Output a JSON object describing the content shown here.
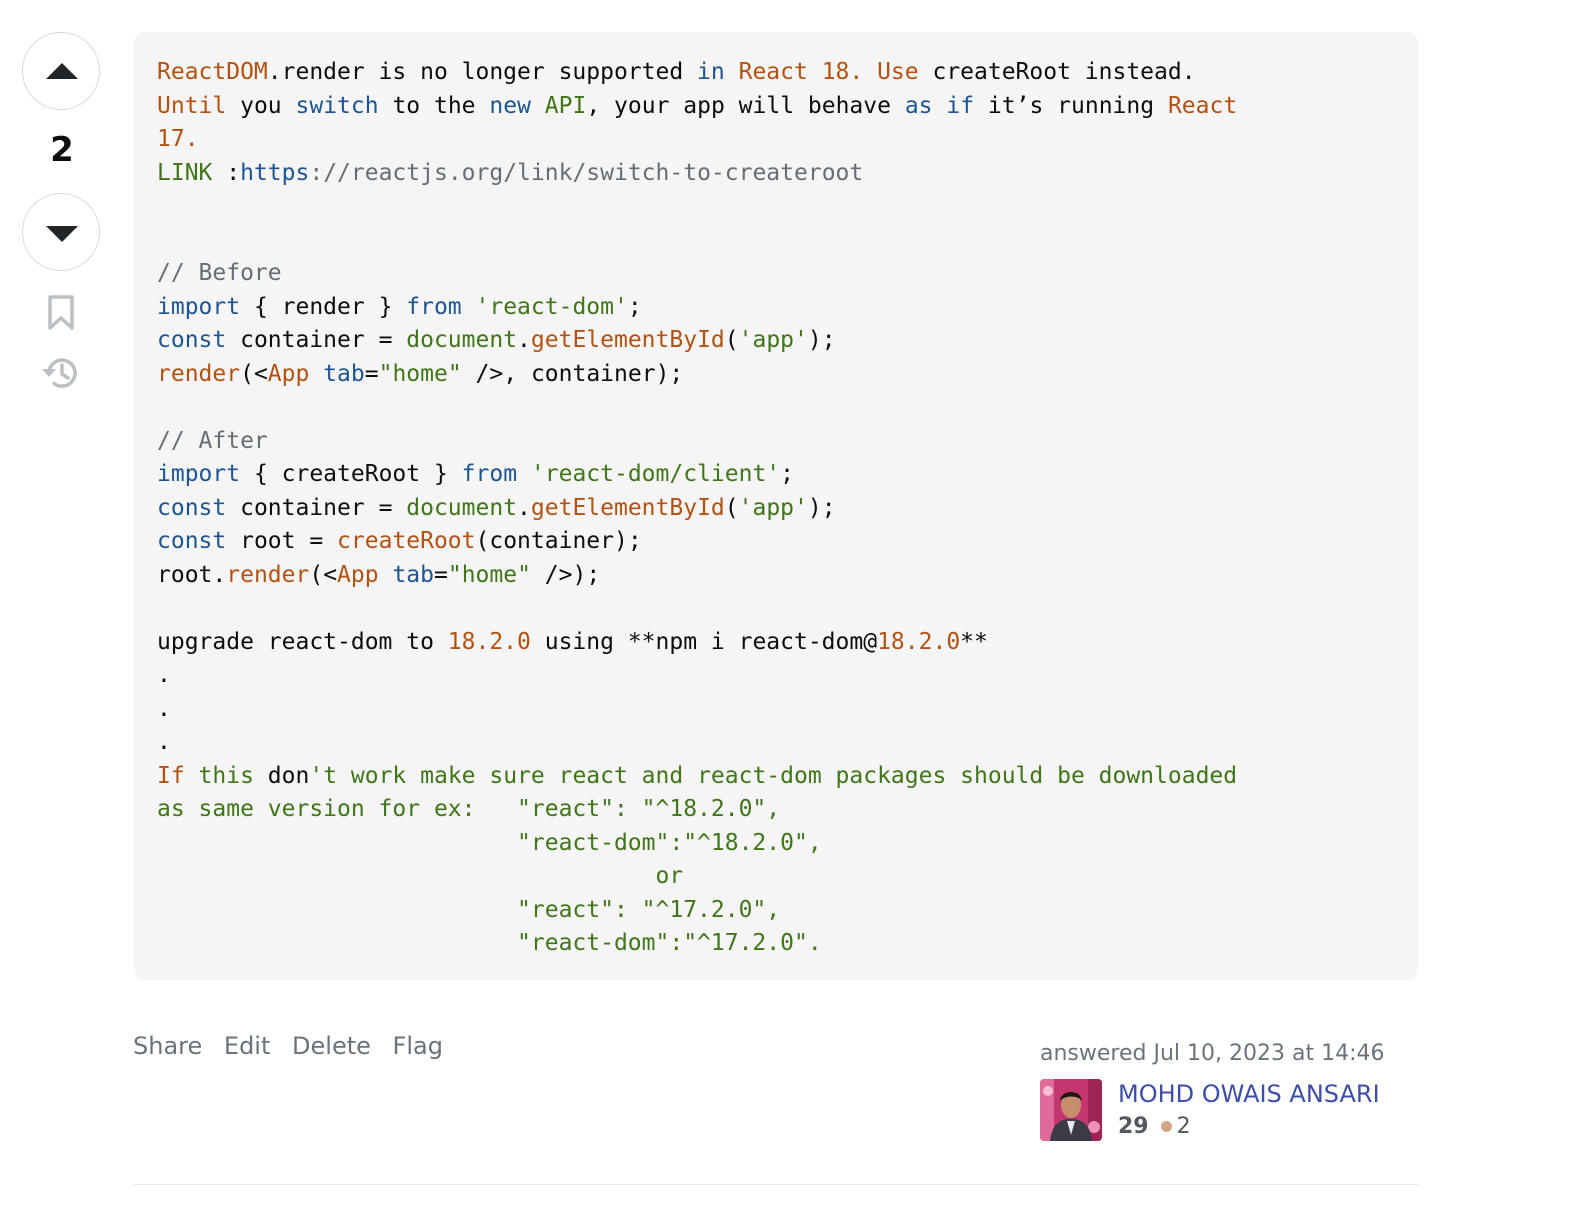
{
  "vote": {
    "count": "2"
  },
  "code": {
    "lines": [
      [
        {
          "t": "ReactDOM",
          "c": "lit"
        },
        {
          "t": ".render is no longer supported ",
          "c": "pun"
        },
        {
          "t": "in",
          "c": "kw"
        },
        {
          "t": " ",
          "c": "pun"
        },
        {
          "t": "React 18. Use",
          "c": "lit"
        },
        {
          "t": " createRoot instead.",
          "c": "pun"
        }
      ],
      [
        {
          "t": "Until",
          "c": "lit"
        },
        {
          "t": " you ",
          "c": "pun"
        },
        {
          "t": "switch",
          "c": "kw"
        },
        {
          "t": " to the ",
          "c": "pun"
        },
        {
          "t": "new",
          "c": "kw"
        },
        {
          "t": " ",
          "c": "pun"
        },
        {
          "t": "API",
          "c": "str"
        },
        {
          "t": ", your app will behave ",
          "c": "pun"
        },
        {
          "t": "as if",
          "c": "kw"
        },
        {
          "t": " it’s running ",
          "c": "pun"
        },
        {
          "t": "React",
          "c": "lit"
        }
      ],
      [
        {
          "t": "17.",
          "c": "lit"
        }
      ],
      [
        {
          "t": "LINK",
          "c": "str"
        },
        {
          "t": " :",
          "c": "pun"
        },
        {
          "t": "https",
          "c": "url"
        },
        {
          "t": "://reactjs.org/link/switch-to-createroot",
          "c": "com"
        }
      ],
      [],
      [],
      [
        {
          "t": "// Before",
          "c": "com"
        }
      ],
      [
        {
          "t": "import",
          "c": "kw"
        },
        {
          "t": " { render } ",
          "c": "pun"
        },
        {
          "t": "from",
          "c": "kw"
        },
        {
          "t": " ",
          "c": "pun"
        },
        {
          "t": "'react-dom'",
          "c": "str"
        },
        {
          "t": ";",
          "c": "pun"
        }
      ],
      [
        {
          "t": "const",
          "c": "kw"
        },
        {
          "t": " container = ",
          "c": "pun"
        },
        {
          "t": "document",
          "c": "str"
        },
        {
          "t": ".",
          "c": "pun"
        },
        {
          "t": "getElementById",
          "c": "lit"
        },
        {
          "t": "(",
          "c": "pun"
        },
        {
          "t": "'app'",
          "c": "str"
        },
        {
          "t": ");",
          "c": "pun"
        }
      ],
      [
        {
          "t": "render",
          "c": "lit"
        },
        {
          "t": "(<",
          "c": "pun"
        },
        {
          "t": "App",
          "c": "lit"
        },
        {
          "t": " ",
          "c": "pun"
        },
        {
          "t": "tab",
          "c": "kw"
        },
        {
          "t": "=",
          "c": "pun"
        },
        {
          "t": "\"home\"",
          "c": "str"
        },
        {
          "t": " />, container);",
          "c": "pun"
        }
      ],
      [],
      [
        {
          "t": "// After",
          "c": "com"
        }
      ],
      [
        {
          "t": "import",
          "c": "kw"
        },
        {
          "t": " { createRoot } ",
          "c": "pun"
        },
        {
          "t": "from",
          "c": "kw"
        },
        {
          "t": " ",
          "c": "pun"
        },
        {
          "t": "'react-dom/client'",
          "c": "str"
        },
        {
          "t": ";",
          "c": "pun"
        }
      ],
      [
        {
          "t": "const",
          "c": "kw"
        },
        {
          "t": " container = ",
          "c": "pun"
        },
        {
          "t": "document",
          "c": "str"
        },
        {
          "t": ".",
          "c": "pun"
        },
        {
          "t": "getElementById",
          "c": "lit"
        },
        {
          "t": "(",
          "c": "pun"
        },
        {
          "t": "'app'",
          "c": "str"
        },
        {
          "t": ");",
          "c": "pun"
        }
      ],
      [
        {
          "t": "const",
          "c": "kw"
        },
        {
          "t": " root = ",
          "c": "pun"
        },
        {
          "t": "createRoot",
          "c": "lit"
        },
        {
          "t": "(container);",
          "c": "pun"
        }
      ],
      [
        {
          "t": "root.",
          "c": "pun"
        },
        {
          "t": "render",
          "c": "lit"
        },
        {
          "t": "(<",
          "c": "pun"
        },
        {
          "t": "App",
          "c": "lit"
        },
        {
          "t": " ",
          "c": "pun"
        },
        {
          "t": "tab",
          "c": "kw"
        },
        {
          "t": "=",
          "c": "pun"
        },
        {
          "t": "\"home\"",
          "c": "str"
        },
        {
          "t": " />);",
          "c": "pun"
        }
      ],
      [],
      [
        {
          "t": "upgrade react-dom to ",
          "c": "pun"
        },
        {
          "t": "18.2.0",
          "c": "lit"
        },
        {
          "t": " using **npm i react-dom@",
          "c": "pun"
        },
        {
          "t": "18.2.0",
          "c": "lit"
        },
        {
          "t": "**",
          "c": "pun"
        }
      ],
      [
        {
          "t": ".",
          "c": "pun"
        }
      ],
      [
        {
          "t": ".",
          "c": "pun"
        }
      ],
      [
        {
          "t": ".",
          "c": "pun"
        }
      ],
      [
        {
          "t": "If",
          "c": "lit"
        },
        {
          "t": " this ",
          "c": "str"
        },
        {
          "t": "don",
          "c": "pun"
        },
        {
          "t": "'t work make sure react and react-dom packages should be downloaded",
          "c": "str"
        }
      ],
      [
        {
          "t": "as same version for ex:   \"react\": \"^18.2.0\",",
          "c": "str"
        }
      ],
      [
        {
          "t": "                          \"react-dom\":\"^18.2.0\",",
          "c": "str"
        }
      ],
      [
        {
          "t": "                                    or",
          "c": "str"
        }
      ],
      [
        {
          "t": "                          \"react\": \"^17.2.0\",",
          "c": "str"
        }
      ],
      [
        {
          "t": "                          \"react-dom\":\"^17.2.0\".",
          "c": "str"
        }
      ]
    ]
  },
  "post_menu": {
    "share": "Share",
    "edit": "Edit",
    "delete": "Delete",
    "flag": "Flag"
  },
  "user_card": {
    "action_time": "answered Jul 10, 2023 at 14:46",
    "user_name": "MOHD OWAIS ANSARI",
    "reputation": "29",
    "bronze_badges": "2"
  },
  "colors": {
    "keyword": "#1d5593",
    "literal": "#b45111",
    "string": "#3e7618",
    "comment": "#656e77",
    "link": "#3d4ea8",
    "bronze": "#d1a684"
  },
  "icons": [
    "arrow-up-icon",
    "arrow-down-icon",
    "bookmark-icon",
    "history-icon",
    "user-avatar"
  ]
}
